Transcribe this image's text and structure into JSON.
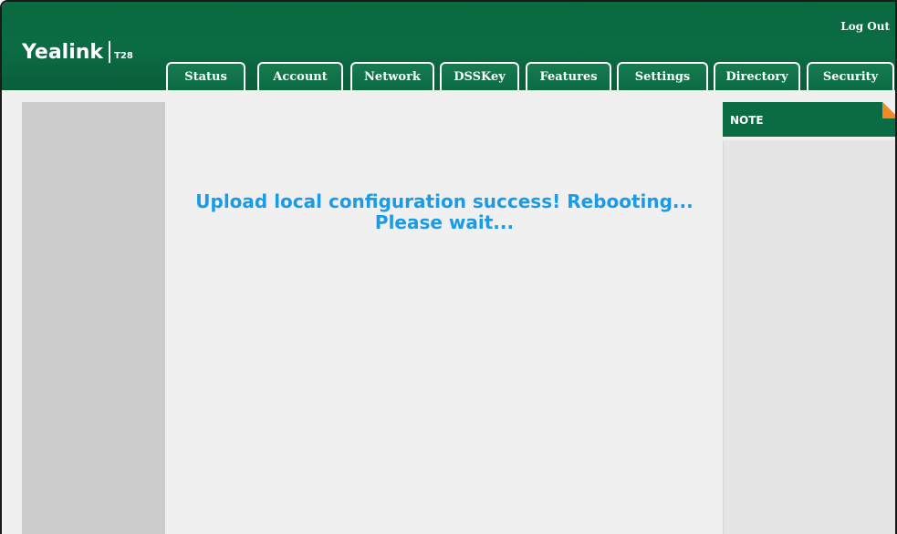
{
  "brand": {
    "wordmark": "Yealink",
    "model": "T28"
  },
  "header": {
    "logout_label": "Log Out"
  },
  "tabs": [
    {
      "label": "Status"
    },
    {
      "label": "Account"
    },
    {
      "label": "Network"
    },
    {
      "label": "DSSKey"
    },
    {
      "label": "Features"
    },
    {
      "label": "Settings"
    },
    {
      "label": "Directory"
    },
    {
      "label": "Security"
    }
  ],
  "message": {
    "line1": "Upload local configuration success! Rebooting...",
    "line2": "Please wait..."
  },
  "note": {
    "title": "NOTE"
  },
  "colors": {
    "header_green": "#0b6b43",
    "message_blue": "#1a9be8",
    "note_corner": "#f08a24"
  }
}
